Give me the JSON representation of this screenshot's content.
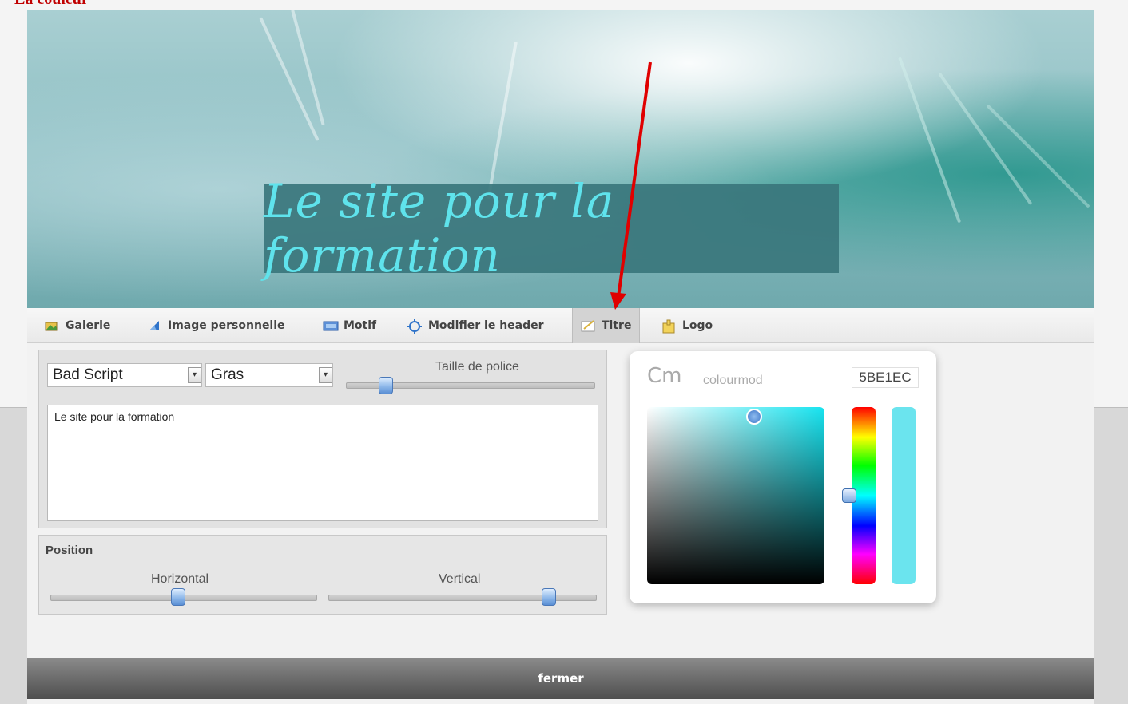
{
  "caption": "La couleur",
  "header": {
    "title": "Le site pour la formation"
  },
  "tabs": [
    {
      "label": "Galerie",
      "icon": "gallery-icon"
    },
    {
      "label": "Image personnelle",
      "icon": "personal-image-icon"
    },
    {
      "label": "Motif",
      "icon": "pattern-icon"
    },
    {
      "label": "Modifier le header",
      "icon": "edit-header-icon"
    },
    {
      "label": "Titre",
      "icon": "title-icon",
      "active": true
    },
    {
      "label": "Logo",
      "icon": "logo-icon"
    }
  ],
  "title_editor": {
    "font_select": "Bad Script",
    "weight_select": "Gras",
    "size_label": "Taille de police",
    "size_level": 0.16,
    "text": "Le site pour la formation"
  },
  "position": {
    "heading": "Position",
    "horizontal_label": "Horizontal",
    "horizontal_level": 0.48,
    "vertical_label": "Vertical",
    "vertical_level": 0.82
  },
  "colour_picker": {
    "brand": "colourmod",
    "hex": "5BE1EC",
    "preview_color": "#5BE1EC"
  },
  "footer": {
    "close_label": "fermer"
  },
  "colors": {
    "annotation_arrow": "#e00000",
    "title_text": "#5fe3ec"
  }
}
